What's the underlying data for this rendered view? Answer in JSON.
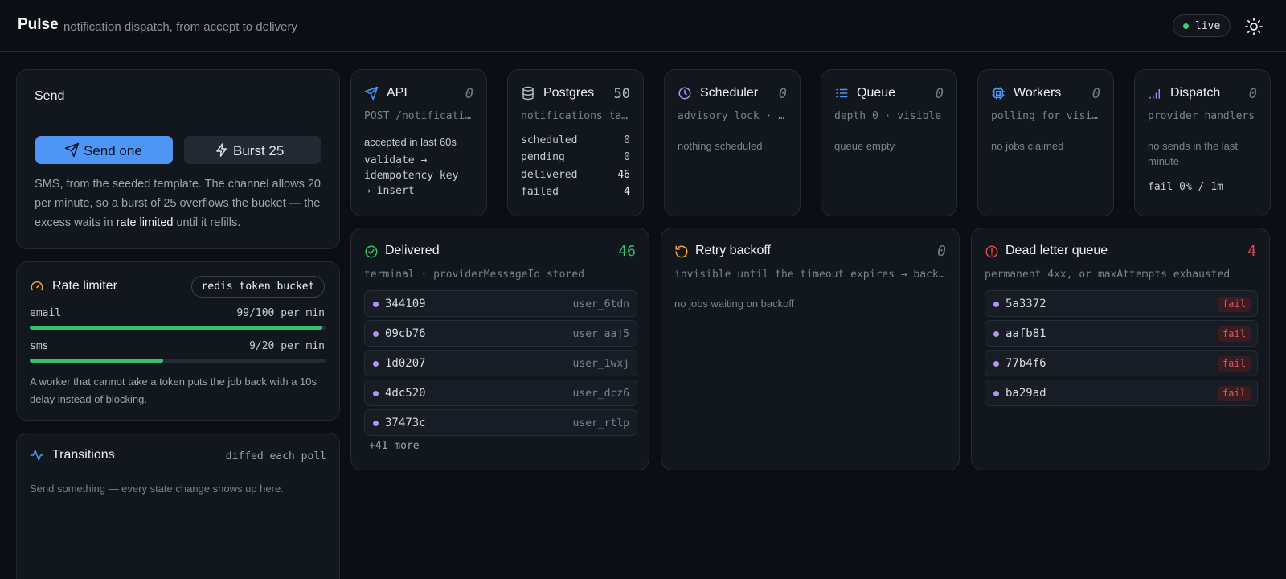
{
  "header": {
    "brand": "Pulse",
    "tagline": "notification dispatch, from accept to delivery",
    "status": "live",
    "status_color": "#34d17a"
  },
  "send": {
    "title": "Send",
    "send_one_label": "Send one",
    "burst_label": "Burst 25",
    "desc_before": "SMS, from the seeded template. The channel allows 20 per minute, so a burst of 25 overflows the bucket — the excess waits in ",
    "desc_highlight": "rate limited",
    "desc_after": " until it refills."
  },
  "rate_limiter": {
    "title": "Rate limiter",
    "badge": "redis token bucket",
    "buckets": [
      {
        "name": "email",
        "value": "99/100 per min",
        "fill": 0.99
      },
      {
        "name": "sms",
        "value": "9/20 per min",
        "fill": 0.45
      }
    ],
    "note": "A worker that cannot take a token puts the job back with a 10s delay instead of blocking."
  },
  "transitions": {
    "title": "Transitions",
    "meta": "diffed each poll",
    "empty": "Send something — every state change shows up here."
  },
  "stages": [
    {
      "name": "API",
      "icon": "send-icon",
      "count": "0",
      "sub": "POST /notifications",
      "note": "accepted in last 60s",
      "mono": [
        "validate →",
        "idempotency key",
        "→ insert"
      ]
    },
    {
      "name": "Postgres",
      "icon": "database-icon",
      "count": "50",
      "sub": "notifications table",
      "rows": [
        {
          "label": "scheduled",
          "value": "0"
        },
        {
          "label": "pending",
          "value": "0"
        },
        {
          "label": "delivered",
          "value": "46"
        },
        {
          "label": "failed",
          "value": "4"
        }
      ]
    },
    {
      "name": "Scheduler",
      "icon": "clock-icon",
      "count": "0",
      "sub": "advisory lock · sweep",
      "note": "nothing scheduled"
    },
    {
      "name": "Queue",
      "icon": "list-icon",
      "count": "0",
      "sub": "depth 0 · visible",
      "note": "queue empty"
    },
    {
      "name": "Workers",
      "icon": "cpu-icon",
      "count": "0",
      "sub": "polling for visible jobs",
      "note": "no jobs claimed"
    },
    {
      "name": "Dispatch",
      "icon": "signal-icon",
      "count": "0",
      "sub": "provider handlers",
      "note": "no sends in the last minute",
      "mono": [
        "fail 0% / 1m"
      ]
    }
  ],
  "delivered": {
    "title": "Delivered",
    "count": "46",
    "count_color": "#34c26f",
    "sub": "terminal · providerMessageId stored",
    "items": [
      {
        "id": "344109",
        "user": "user_6tdn"
      },
      {
        "id": "09cb76",
        "user": "user_aaj5"
      },
      {
        "id": "1d0207",
        "user": "user_1wxj"
      },
      {
        "id": "4dc520",
        "user": "user_dcz6"
      },
      {
        "id": "37473c",
        "user": "user_rtlp"
      }
    ],
    "more": "+41 more"
  },
  "retry": {
    "title": "Retry backoff",
    "count": "0",
    "sub": "invisible until the timeout expires → back to queue",
    "empty": "no jobs waiting on backoff"
  },
  "dlq": {
    "title": "Dead letter queue",
    "count": "4",
    "count_color": "#e5484d",
    "sub": "permanent 4xx, or maxAttempts exhausted",
    "items": [
      {
        "id": "5a3372",
        "status": "fail"
      },
      {
        "id": "aafb81",
        "status": "fail"
      },
      {
        "id": "77b4f6",
        "status": "fail"
      },
      {
        "id": "ba29ad",
        "status": "fail"
      }
    ]
  }
}
